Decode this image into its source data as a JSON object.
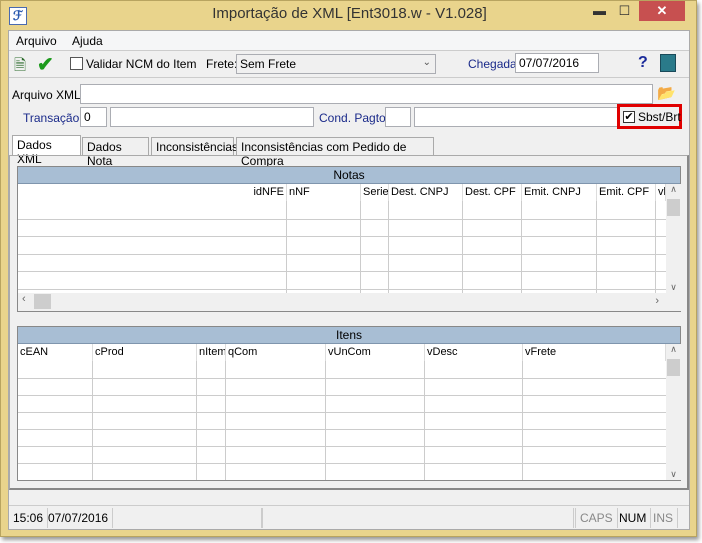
{
  "window": {
    "title": "Importação de XML [Ent3018.w - V1.028]",
    "minimize": "▬",
    "maximize": "☐",
    "close": "✕"
  },
  "menu": [
    "Arquivo",
    "Ajuda"
  ],
  "toolbar": {
    "validar_label": "Validar NCM do Item",
    "validar_checked": false,
    "frete_label": "Frete:",
    "frete_value": "Sem Frete",
    "chegada_label": "Chegada:",
    "chegada_value": "07/07/2016",
    "help": "?"
  },
  "form": {
    "arquivo_label": "Arquivo XML:",
    "arquivo_value": "",
    "transacao_label": "Transação:",
    "transacao_value": "0",
    "transacao_desc": "",
    "cond_label": "Cond. Pagto:",
    "cond_value": "",
    "cond_desc": "",
    "sbst_label": "Sbst/Brt",
    "sbst_checked": true
  },
  "tabs": [
    "Dados XML",
    "Dados Nota",
    "Inconsistências",
    "Inconsistências com Pedido de Compra"
  ],
  "notas": {
    "title": "Notas",
    "columns": [
      "idNFE",
      "nNF",
      "Serie",
      "Dest. CNPJ",
      "Dest. CPF",
      "Emit. CNPJ",
      "Emit. CPF",
      "vl"
    ]
  },
  "itens": {
    "title": "Itens",
    "columns": [
      "cEAN",
      "cProd",
      "nItem",
      "qCom",
      "vUnCom",
      "vDesc",
      "vFrete"
    ]
  },
  "status": {
    "time": "15:06",
    "date": "07/07/2016",
    "caps": "CAPS",
    "num": "NUM",
    "ins": "INS"
  },
  "colors": {
    "frame": "#e9d48c",
    "grid_header": "#a8bed4",
    "highlight": "#e00000",
    "close": "#c75050"
  }
}
